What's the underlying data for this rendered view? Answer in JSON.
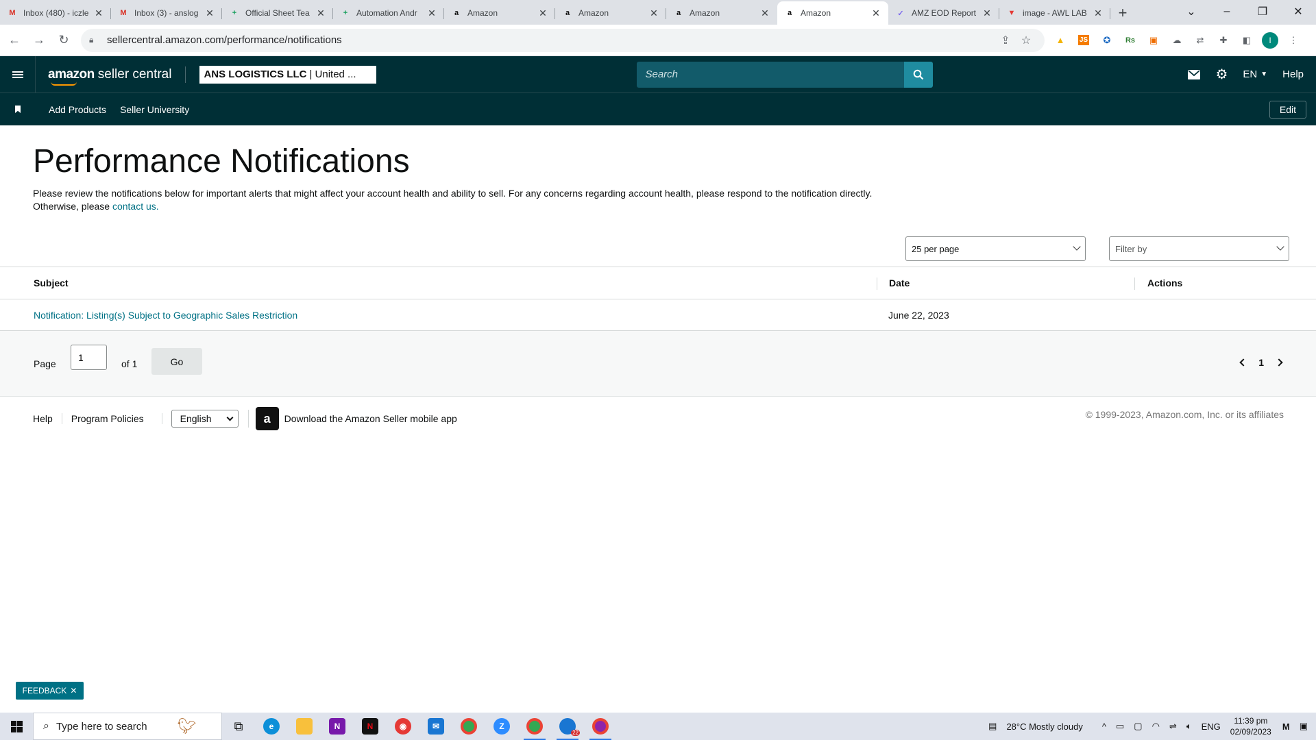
{
  "browser": {
    "tabs": [
      {
        "title": "Inbox (480) - iczle",
        "favicon": "gmail-icon",
        "color": "#d93025",
        "glyph": "M"
      },
      {
        "title": "Inbox (3) - anslog",
        "favicon": "gmail-icon",
        "color": "#d93025",
        "glyph": "M"
      },
      {
        "title": "Official Sheet Tea",
        "favicon": "sheets-icon",
        "color": "#0f9d58",
        "glyph": "+"
      },
      {
        "title": "Automation Andr",
        "favicon": "sheets-icon",
        "color": "#0f9d58",
        "glyph": "+"
      },
      {
        "title": "Amazon",
        "favicon": "amazon-icon",
        "color": "#111111",
        "glyph": "a"
      },
      {
        "title": "Amazon",
        "favicon": "amazon-icon",
        "color": "#111111",
        "glyph": "a"
      },
      {
        "title": "Amazon",
        "favicon": "amazon-icon",
        "color": "#111111",
        "glyph": "a"
      },
      {
        "title": "Amazon",
        "favicon": "amazon-icon",
        "color": "#111111",
        "glyph": "a"
      },
      {
        "title": "AMZ EOD Report",
        "favicon": "clickup-icon",
        "color": "#7b68ee",
        "glyph": "✓"
      },
      {
        "title": "image - AWL LAB",
        "favicon": "triangle-icon",
        "color": "#e53935",
        "glyph": "▼"
      }
    ],
    "active_tab_index": 7,
    "url": "sellercentral.amazon.com/performance/notifications"
  },
  "header": {
    "logo_bold": "amazon",
    "logo_rest": "seller central",
    "account_name": "ANS LOGISTICS LLC",
    "account_region": "| United ...",
    "search_placeholder": "Search",
    "language": "EN",
    "help": "Help"
  },
  "nav": {
    "links": [
      "Add Products",
      "Seller University"
    ],
    "edit": "Edit"
  },
  "page": {
    "title": "Performance Notifications",
    "description": "Please review the notifications below for important alerts that might affect your account health and ability to sell. For any concerns regarding account health, please respond to the notification directly. Otherwise, please",
    "contact_link": "contact us."
  },
  "controls": {
    "per_page": "25 per page",
    "filter_placeholder": "Filter by"
  },
  "table": {
    "columns": [
      "Subject",
      "Date",
      "Actions"
    ],
    "rows": [
      {
        "subject": "Notification: Listing(s) Subject to Geographic Sales Restriction",
        "date": "June 22, 2023",
        "actions": ""
      }
    ]
  },
  "pagination": {
    "page_label": "Page",
    "page_value": "1",
    "of_label": "of 1",
    "go": "Go",
    "current": "1"
  },
  "footer": {
    "help": "Help",
    "policies": "Program Policies",
    "language": "English",
    "app_text": "Download the Amazon Seller mobile app",
    "copyright": "© 1999-2023, Amazon.com, Inc. or its affiliates"
  },
  "feedback": "FEEDBACK",
  "taskbar": {
    "search_placeholder": "Type here to search",
    "weather": "28°C  Mostly cloudy",
    "lang": "ENG",
    "time": "11:39 pm",
    "date": "02/09/2023",
    "badge": "22"
  },
  "colors": {
    "header_bg": "#002f36",
    "link": "#007185",
    "search_bg": "#125b6a",
    "search_btn": "#1f8ca0"
  }
}
